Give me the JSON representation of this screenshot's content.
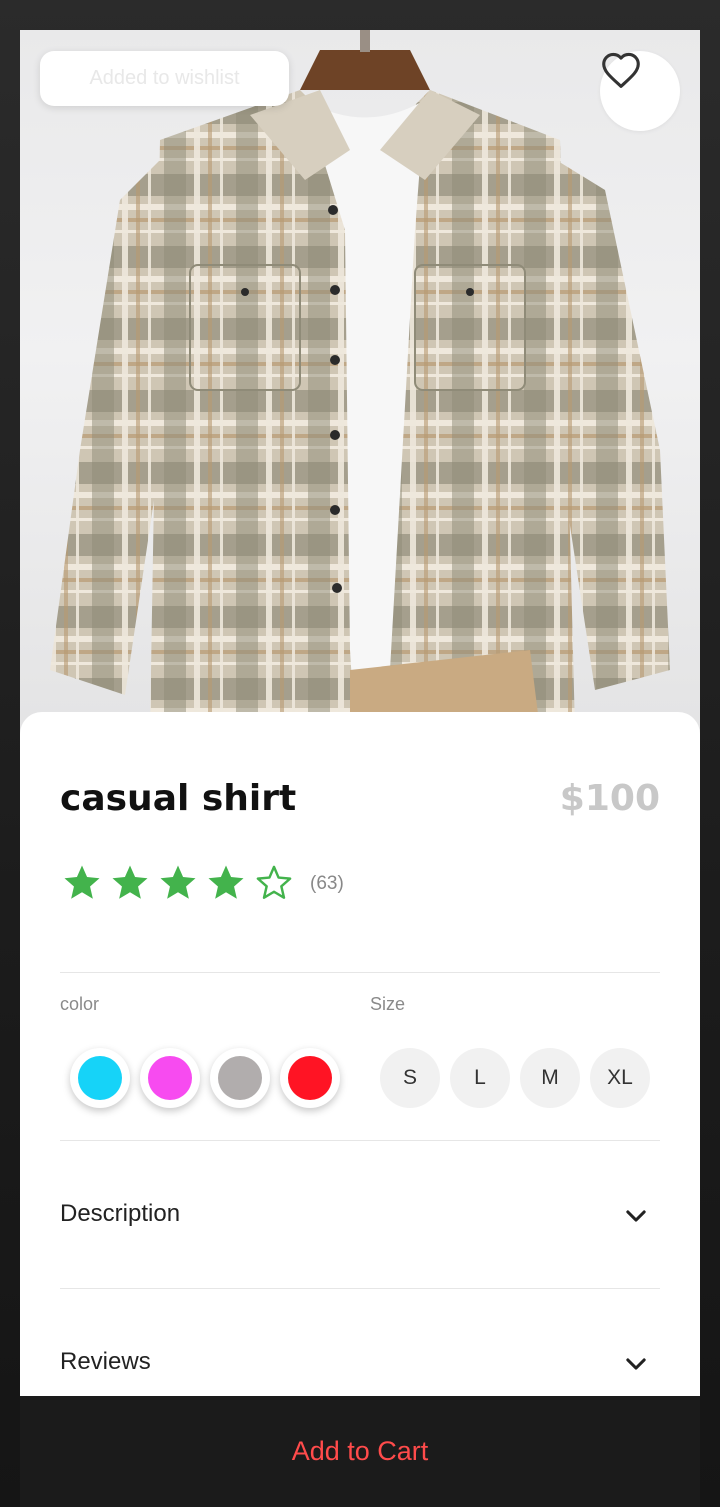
{
  "product": {
    "name": "casual shirt",
    "price": "$100",
    "rating": {
      "stars": 4,
      "max": 5,
      "review_count": "(63)"
    }
  },
  "toast": {
    "message": "Added to wishlist"
  },
  "wishlist": {
    "icon": "heart-outline-icon"
  },
  "options": {
    "color_label": "color",
    "colors": [
      "#16d3f8",
      "#f74bf0",
      "#b1adad",
      "#ff1424"
    ],
    "size_label": "Size",
    "sizes": [
      "S",
      "L",
      "M",
      "XL"
    ]
  },
  "sections": [
    {
      "label": "Description",
      "icon": "chevron-down-icon"
    },
    {
      "label": "Reviews",
      "icon": "chevron-down-icon"
    }
  ],
  "cart_button": {
    "label": "Add to Cart",
    "color": "#ff4b4b"
  },
  "colors": {
    "star_green": "#43b34c",
    "sheet_bg": "#ffffff",
    "bar_bg": "#1b1b1b"
  }
}
